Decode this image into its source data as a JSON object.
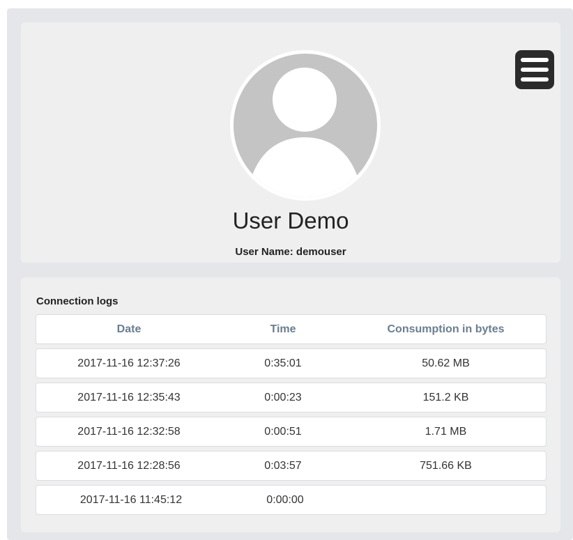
{
  "profile": {
    "full_name": "User Demo",
    "user_name_line": "User Name: demouser",
    "avatar_icon": "user-silhouette-icon",
    "menu_icon": "hamburger-menu-icon"
  },
  "logs": {
    "title": "Connection logs",
    "columns": [
      "Date",
      "Time",
      "Consumption in bytes"
    ],
    "rows": [
      {
        "date": "2017-11-16 12:37:26",
        "time": "0:35:01",
        "bytes": "50.62 MB"
      },
      {
        "date": "2017-11-16 12:35:43",
        "time": "0:00:23",
        "bytes": "151.2 KB"
      },
      {
        "date": "2017-11-16 12:32:58",
        "time": "0:00:51",
        "bytes": "1.71 MB"
      },
      {
        "date": "2017-11-16 12:28:56",
        "time": "0:03:57",
        "bytes": "751.66 KB"
      },
      {
        "date": "2017-11-16 11:45:12",
        "time": "0:00:00",
        "bytes": ""
      }
    ]
  },
  "colors": {
    "frame_background": "#e4e6ea",
    "panel_background": "#efefef",
    "header_text": "#6a7d91",
    "menu_button": "#2b2b2b",
    "avatar_gray": "#c4c4c4"
  }
}
